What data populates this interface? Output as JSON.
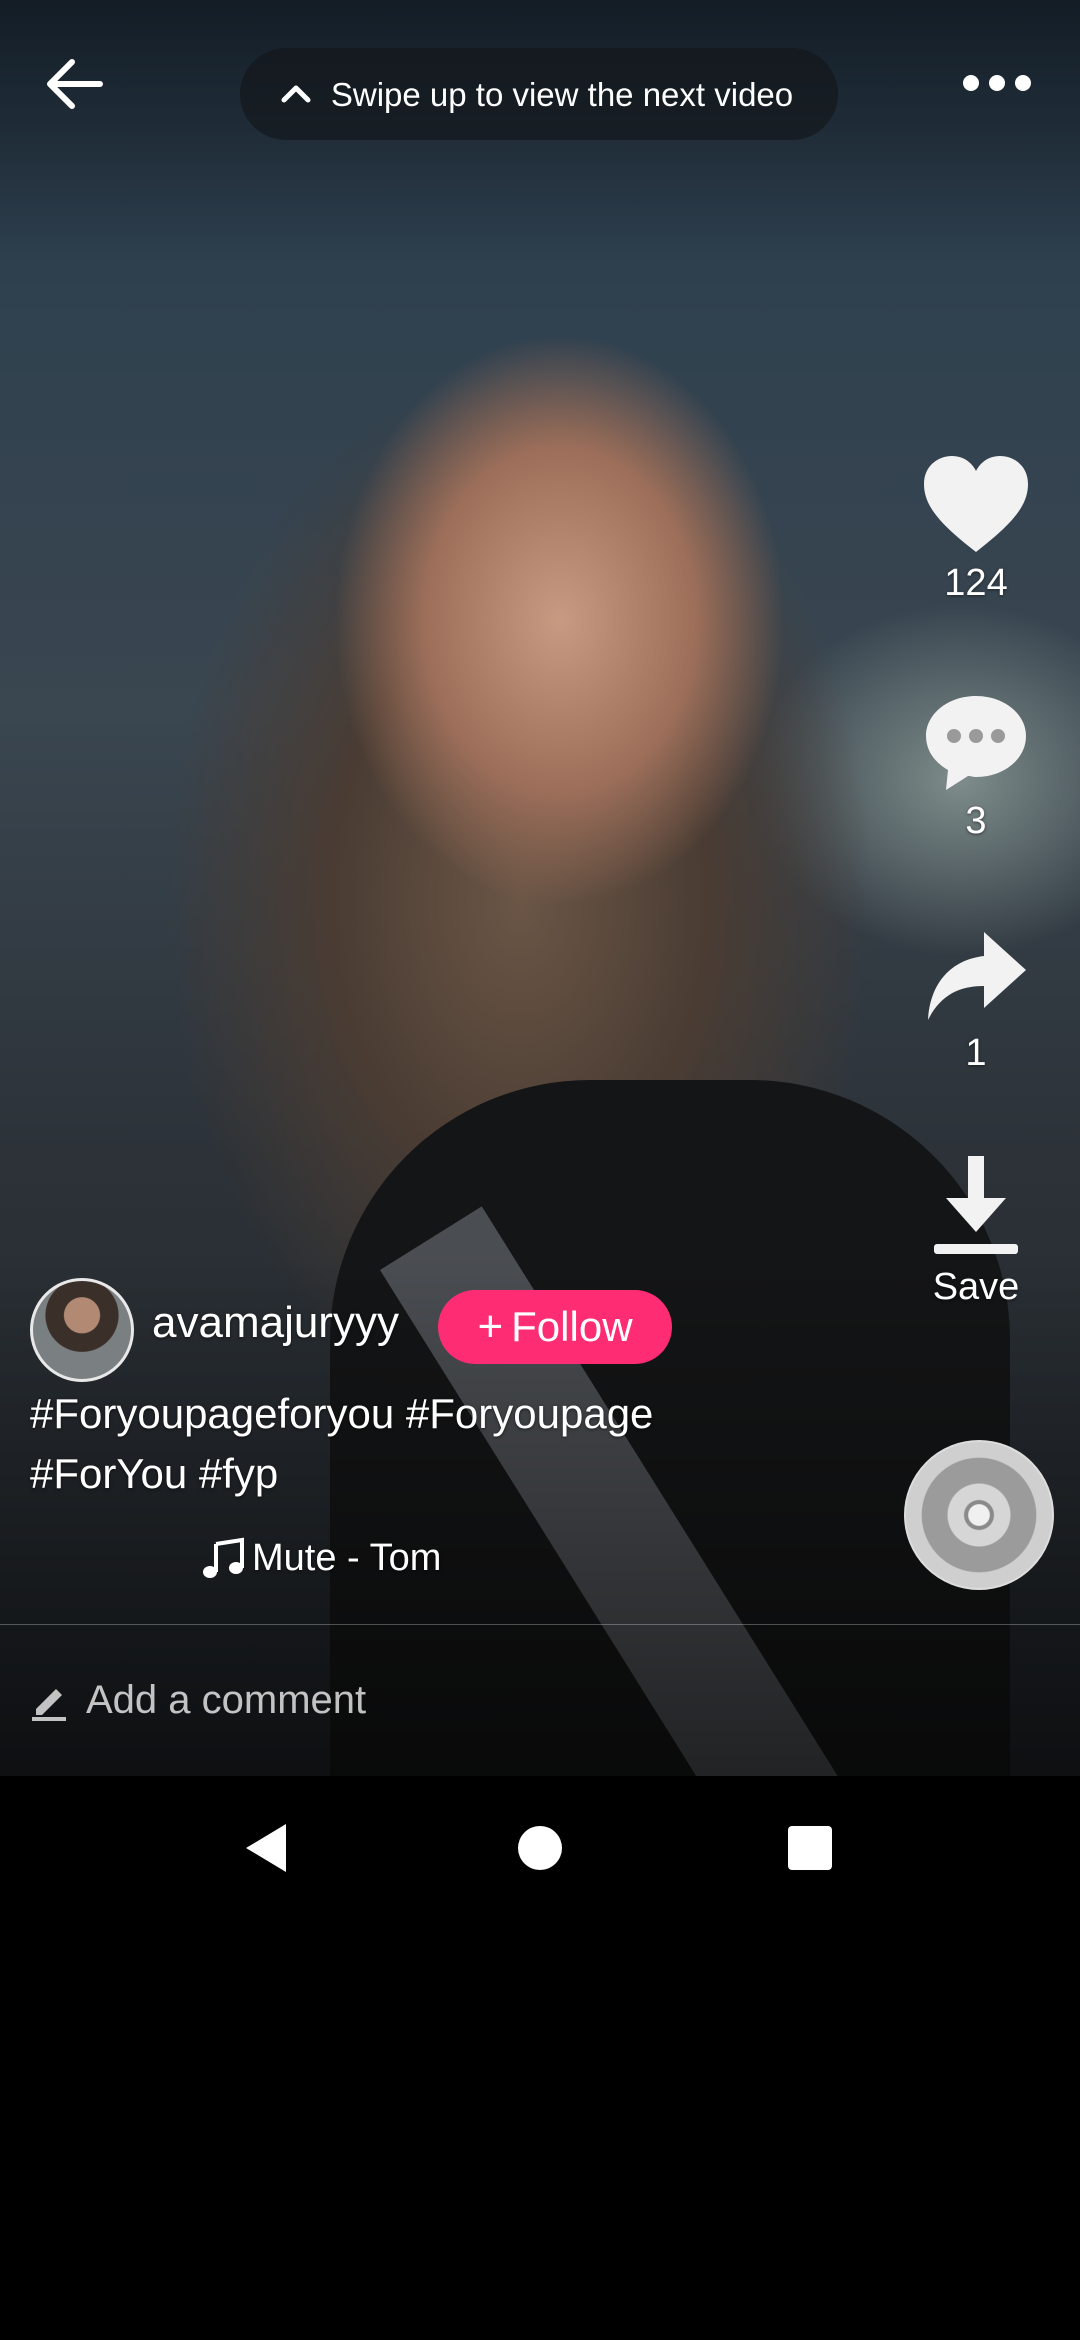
{
  "header": {
    "back_icon": "arrow-left-icon",
    "swipe_hint": "Swipe up to view the next video",
    "swipe_icon": "chevron-up-icon",
    "more_icon": "more-horizontal-icon"
  },
  "actions": {
    "like_count": "124",
    "comment_count": "3",
    "share_count": "1",
    "save_label": "Save"
  },
  "post": {
    "username": "avamajuryyy",
    "follow_label": "Follow",
    "caption": "#Foryoupageforyou #Foryoupage #ForYou #fyp",
    "music": "Mute - Tom"
  },
  "comment": {
    "placeholder": "Add a comment"
  },
  "colors": {
    "accent": "#fe2c73",
    "text": "#ffffff",
    "background": "#000000"
  },
  "system_nav": {
    "back": "nav-back-icon",
    "home": "nav-home-icon",
    "recents": "nav-recents-icon"
  }
}
